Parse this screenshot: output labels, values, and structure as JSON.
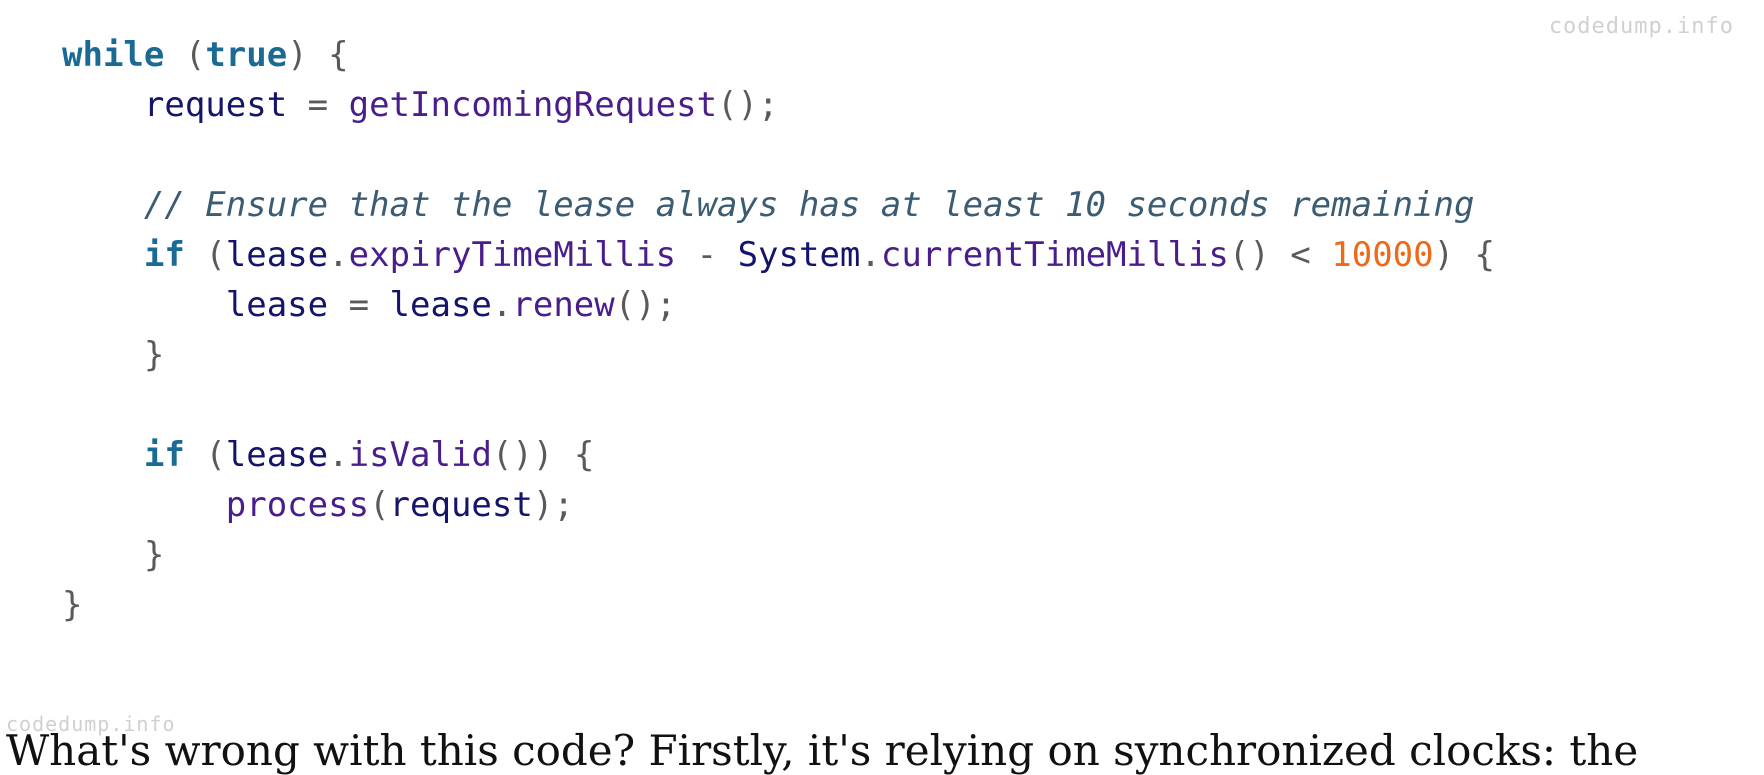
{
  "watermark": "codedump.info",
  "code_lines": [
    {
      "indent": 0,
      "tokens": [
        [
          "kw",
          "while"
        ],
        [
          "punc",
          " ("
        ],
        [
          "kw",
          "true"
        ],
        [
          "punc",
          ") {"
        ]
      ]
    },
    {
      "indent": 1,
      "tokens": [
        [
          "id",
          "request"
        ],
        [
          "punc",
          " = "
        ],
        [
          "meth",
          "getIncomingRequest"
        ],
        [
          "punc",
          "();"
        ]
      ]
    },
    {
      "indent": 0,
      "tokens": []
    },
    {
      "indent": 1,
      "tokens": [
        [
          "cmt",
          "// Ensure that the lease always has at least 10 seconds remaining"
        ]
      ]
    },
    {
      "indent": 1,
      "tokens": [
        [
          "kw",
          "if"
        ],
        [
          "punc",
          " ("
        ],
        [
          "id",
          "lease"
        ],
        [
          "punc",
          "."
        ],
        [
          "meth",
          "expiryTimeMillis"
        ],
        [
          "punc",
          " - "
        ],
        [
          "id",
          "System"
        ],
        [
          "punc",
          "."
        ],
        [
          "meth",
          "currentTimeMillis"
        ],
        [
          "punc",
          "() < "
        ],
        [
          "num",
          "10000"
        ],
        [
          "punc",
          ") {"
        ]
      ]
    },
    {
      "indent": 2,
      "tokens": [
        [
          "id",
          "lease"
        ],
        [
          "punc",
          " = "
        ],
        [
          "id",
          "lease"
        ],
        [
          "punc",
          "."
        ],
        [
          "meth",
          "renew"
        ],
        [
          "punc",
          "();"
        ]
      ]
    },
    {
      "indent": 1,
      "tokens": [
        [
          "punc",
          "}"
        ]
      ]
    },
    {
      "indent": 0,
      "tokens": []
    },
    {
      "indent": 1,
      "tokens": [
        [
          "kw",
          "if"
        ],
        [
          "punc",
          " ("
        ],
        [
          "id",
          "lease"
        ],
        [
          "punc",
          "."
        ],
        [
          "meth",
          "isValid"
        ],
        [
          "punc",
          "()) {"
        ]
      ]
    },
    {
      "indent": 2,
      "tokens": [
        [
          "meth",
          "process"
        ],
        [
          "punc",
          "("
        ],
        [
          "id",
          "request"
        ],
        [
          "punc",
          ");"
        ]
      ]
    },
    {
      "indent": 1,
      "tokens": [
        [
          "punc",
          "}"
        ]
      ]
    },
    {
      "indent": 0,
      "tokens": [
        [
          "punc",
          "}"
        ]
      ]
    }
  ],
  "prose_line": "What's wrong with this code? Firstly, it's relying on synchronized clocks: the"
}
